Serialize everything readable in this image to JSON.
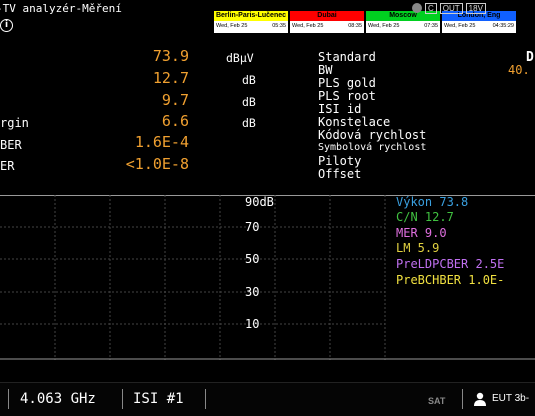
{
  "title": "-TV analyzér-Měření",
  "status": {
    "c": "C",
    "out": "OUT",
    "voltage": "18V"
  },
  "clocks": [
    {
      "city": "Berlin-Paris-Lučenec",
      "date": "Wed, Feb 25",
      "time": "05:35",
      "color": "#ffff00",
      "text_color": "#000"
    },
    {
      "city": "Dubai",
      "date": "Wed, Feb 25",
      "time": "08:35",
      "color": "#ff0000",
      "text_color": "#000"
    },
    {
      "city": "Moscow",
      "date": "Wed, Feb 25",
      "time": "07:35",
      "color": "#00d020",
      "text_color": "#000"
    },
    {
      "city": "London, Eng",
      "date": "Wed, Feb 25",
      "time": "04:35:29",
      "color": "#1060ff",
      "text_color": "#000"
    }
  ],
  "measurements": [
    {
      "label": "",
      "value": "73.9",
      "unit": "dBµV"
    },
    {
      "label": "",
      "value": "12.7",
      "unit": "dB"
    },
    {
      "label": "",
      "value": "9.7",
      "unit": "dB"
    },
    {
      "label": "rgin",
      "value": "6.6",
      "unit": "dB"
    },
    {
      "label": "BER",
      "value": "1.6E-4",
      "unit": ""
    },
    {
      "label": "ER",
      "value": "<1.0E-8",
      "unit": ""
    }
  ],
  "params": [
    {
      "label": "Standard",
      "value": "D"
    },
    {
      "label": "BW",
      "value": "40."
    },
    {
      "label": "PLS gold",
      "value": ""
    },
    {
      "label": "PLS root",
      "value": ""
    },
    {
      "label": "ISI id",
      "value": ""
    },
    {
      "label": "Konstelace",
      "value": ""
    },
    {
      "label": "Kódová rychlost",
      "value": ""
    },
    {
      "label": "Symbolová rychlost",
      "value": ""
    },
    {
      "label": "Piloty",
      "value": ""
    },
    {
      "label": "Offset",
      "value": ""
    }
  ],
  "chart_data": {
    "type": "line",
    "y_ticks": [
      "90dB",
      "70",
      "50",
      "30",
      "10"
    ],
    "legend": [
      {
        "text": "Výkon 73.8",
        "color": "#3aa0e0"
      },
      {
        "text": "C/N 12.7",
        "color": "#40c040"
      },
      {
        "text": "MER 9.0",
        "color": "#e070e0"
      },
      {
        "text": "LM   5.9",
        "color": "#e0d040"
      },
      {
        "text": "PreLDPCBER  2.5E",
        "color": "#c070f0"
      },
      {
        "text": "PreBCHBER  1.0E-",
        "color": "#f0e040"
      }
    ]
  },
  "footer": {
    "frequency": "4.063 GHz",
    "isi": "ISI #1",
    "sat_label": "SAT",
    "user": "EUT 3b-"
  }
}
